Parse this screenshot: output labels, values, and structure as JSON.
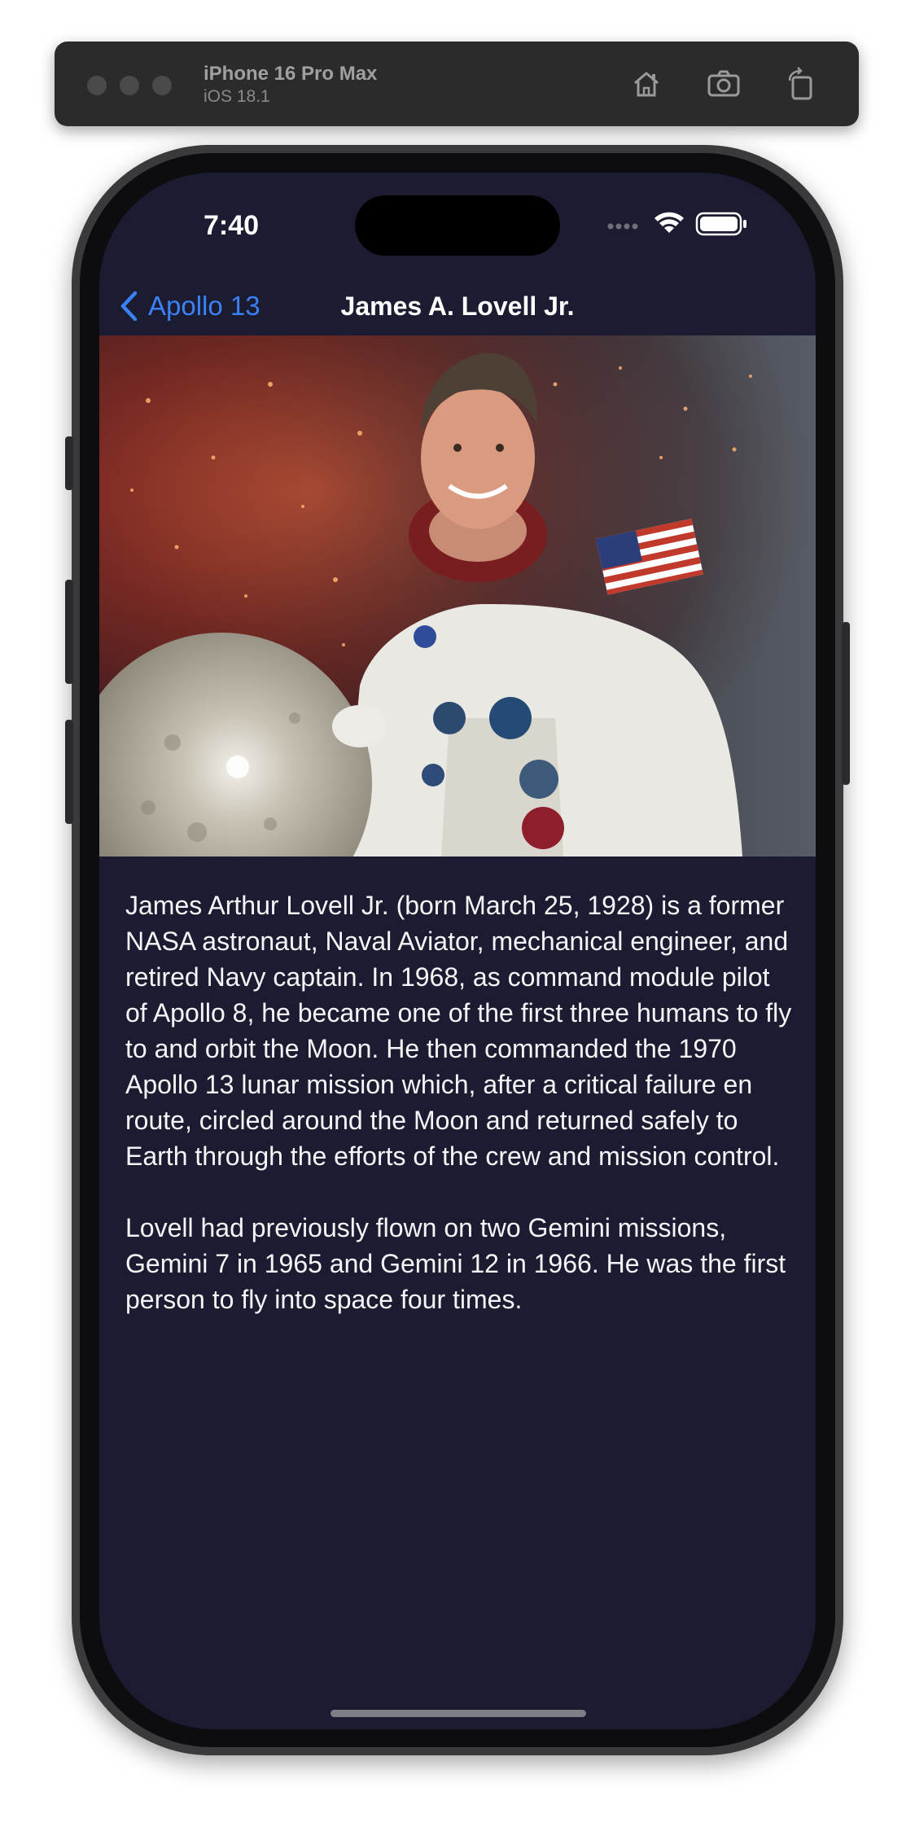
{
  "simulator": {
    "device_name": "iPhone 16 Pro Max",
    "os_version": "iOS 18.1",
    "toolbar_icons": [
      "home-icon",
      "screenshot-icon",
      "rotate-icon"
    ]
  },
  "status_bar": {
    "time": "7:40",
    "icons": [
      "signal-dots-icon",
      "wifi-icon",
      "battery-icon"
    ]
  },
  "nav": {
    "back_label": "Apollo 13",
    "title": "James A. Lovell Jr."
  },
  "content": {
    "photo_description_icon": "astronaut-portrait-image",
    "paragraphs": [
      "James Arthur Lovell Jr. (born March 25, 1928) is a former NASA astronaut, Naval Aviator, mechanical engineer, and retired Navy captain. In 1968, as command module pilot of Apollo 8, he became one of the first three humans to fly to and orbit the Moon. He then commanded the 1970 Apollo 13 lunar mission which, after a critical failure en route, circled around the Moon and returned safely to Earth through the efforts of the crew and mission control.",
      "Lovell had previously flown on two Gemini missions, Gemini 7 in 1965 and Gemini 12 in 1966. He was the first person to fly into space four times."
    ]
  },
  "colors": {
    "screen_background": "#1b1b31",
    "accent": "#3b82f6",
    "text": "#f5f5f7"
  }
}
